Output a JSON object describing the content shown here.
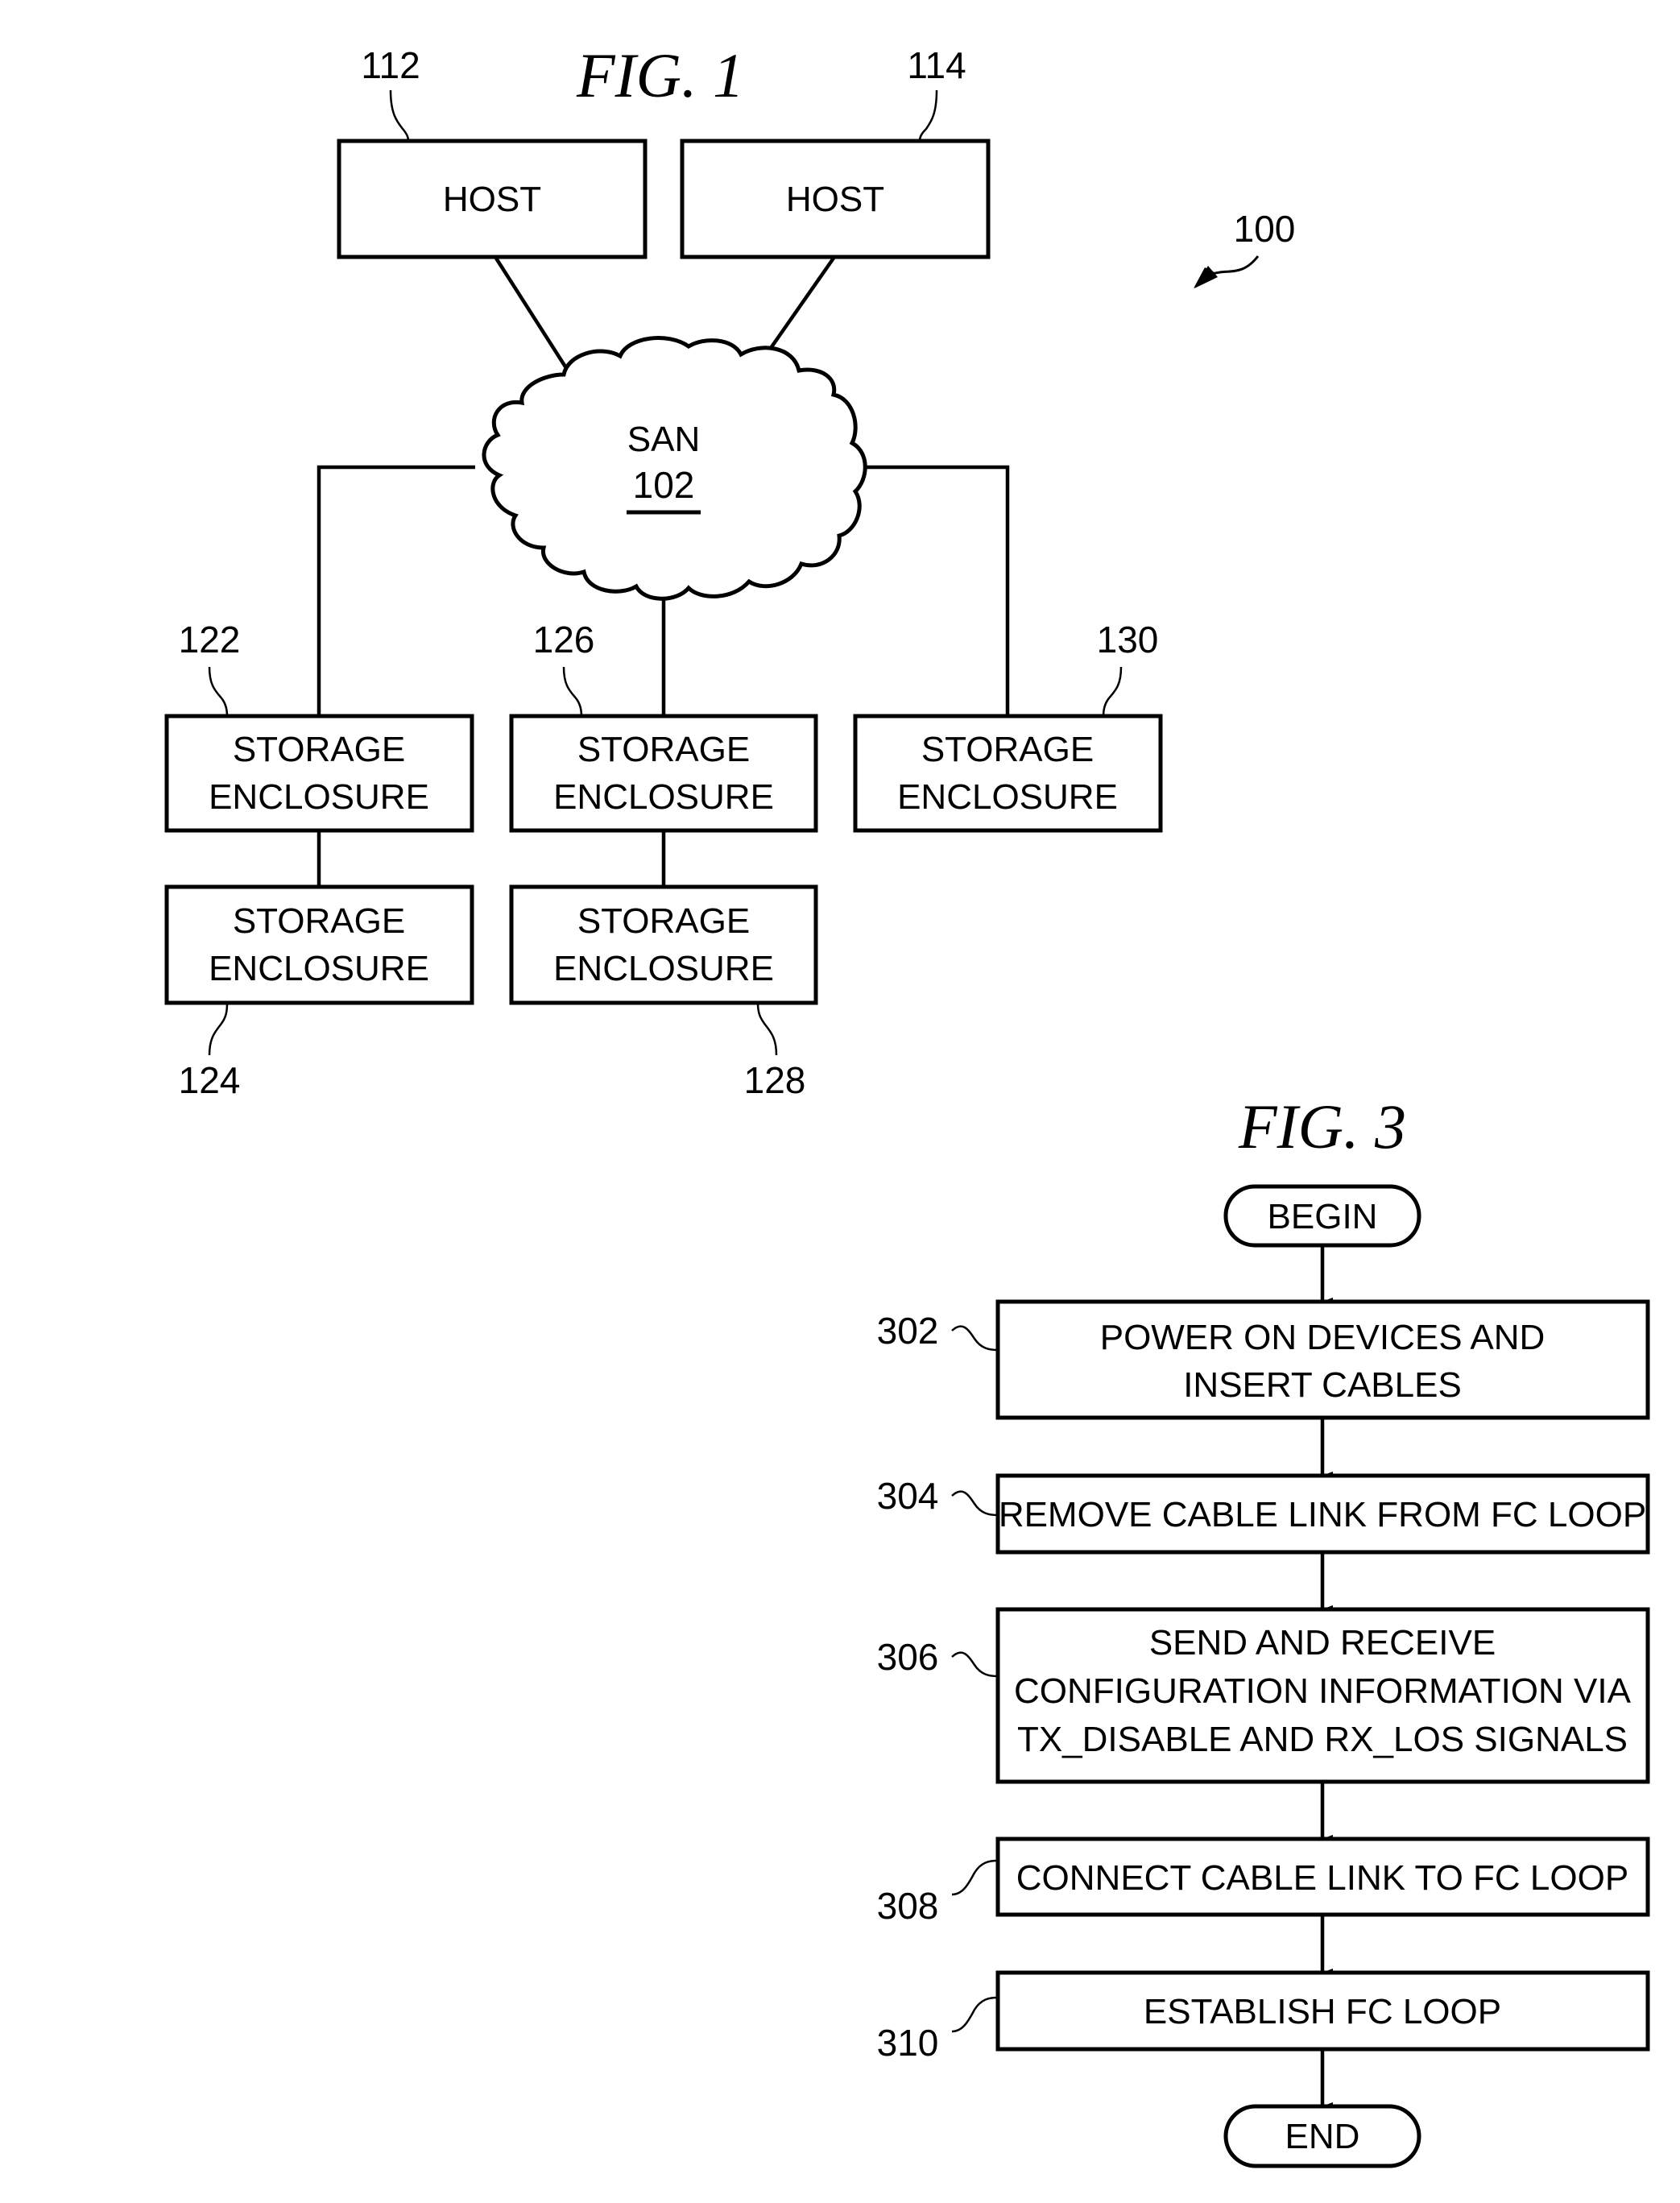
{
  "fig1": {
    "title": "FIG. 1",
    "system_ref": "100",
    "hosts": [
      {
        "ref": "112",
        "label": "HOST"
      },
      {
        "ref": "114",
        "label": "HOST"
      }
    ],
    "san": {
      "label": "SAN",
      "ref": "102"
    },
    "enclosures": [
      {
        "ref": "122",
        "line1": "STORAGE",
        "line2": "ENCLOSURE"
      },
      {
        "ref": "124",
        "line1": "STORAGE",
        "line2": "ENCLOSURE"
      },
      {
        "ref": "126",
        "line1": "STORAGE",
        "line2": "ENCLOSURE"
      },
      {
        "ref": "128",
        "line1": "STORAGE",
        "line2": "ENCLOSURE"
      },
      {
        "ref": "130",
        "line1": "STORAGE",
        "line2": "ENCLOSURE"
      }
    ]
  },
  "fig3": {
    "title": "FIG. 3",
    "begin": "BEGIN",
    "end": "END",
    "steps": [
      {
        "ref": "302",
        "lines": [
          "POWER ON DEVICES AND",
          "INSERT CABLES"
        ]
      },
      {
        "ref": "304",
        "lines": [
          "REMOVE CABLE LINK FROM FC LOOP"
        ]
      },
      {
        "ref": "306",
        "lines": [
          "SEND AND RECEIVE",
          "CONFIGURATION INFORMATION VIA",
          "TX_DISABLE AND RX_LOS SIGNALS"
        ]
      },
      {
        "ref": "308",
        "lines": [
          "CONNECT CABLE LINK TO FC LOOP"
        ]
      },
      {
        "ref": "310",
        "lines": [
          "ESTABLISH FC LOOP"
        ]
      }
    ]
  }
}
